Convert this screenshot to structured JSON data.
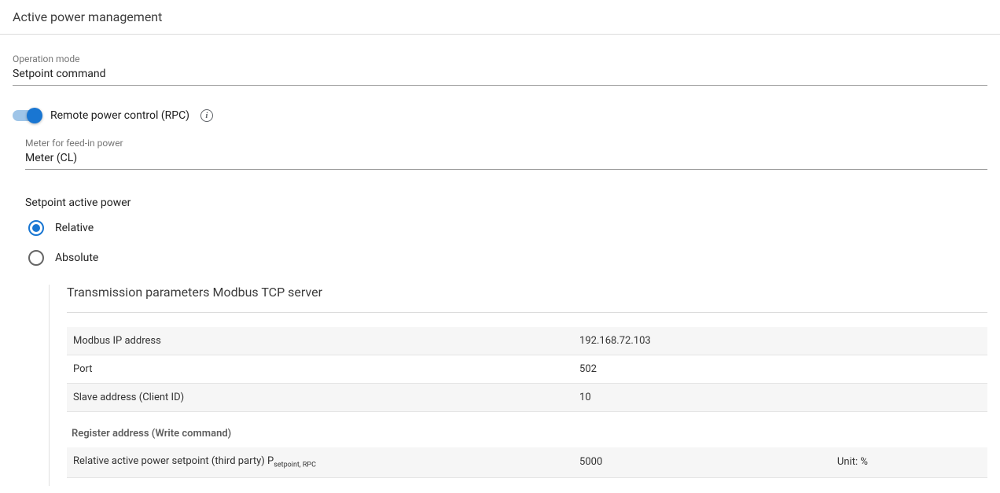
{
  "section": {
    "title": "Active power management"
  },
  "operationMode": {
    "label": "Operation mode",
    "value": "Setpoint command"
  },
  "rpc": {
    "label": "Remote power control (RPC)",
    "enabled": true,
    "info": "i"
  },
  "meter": {
    "label": "Meter for feed-in power",
    "value": "Meter (CL)"
  },
  "setpoint": {
    "groupLabel": "Setpoint active power",
    "options": {
      "relative": "Relative",
      "absolute": "Absolute"
    },
    "selected": "relative"
  },
  "modbus": {
    "title": "Transmission parameters Modbus TCP server",
    "rows": {
      "ip": {
        "label": "Modbus IP address",
        "value": "192.168.72.103"
      },
      "port": {
        "label": "Port",
        "value": "502"
      },
      "slave": {
        "label": "Slave address (Client ID)",
        "value": "10"
      }
    },
    "registerHeader": "Register address (Write command)",
    "register": {
      "labelPrefix": "Relative active power setpoint (third party) P",
      "labelSub": "setpoint, RPC",
      "value": "5000",
      "unit": "Unit: %"
    }
  }
}
